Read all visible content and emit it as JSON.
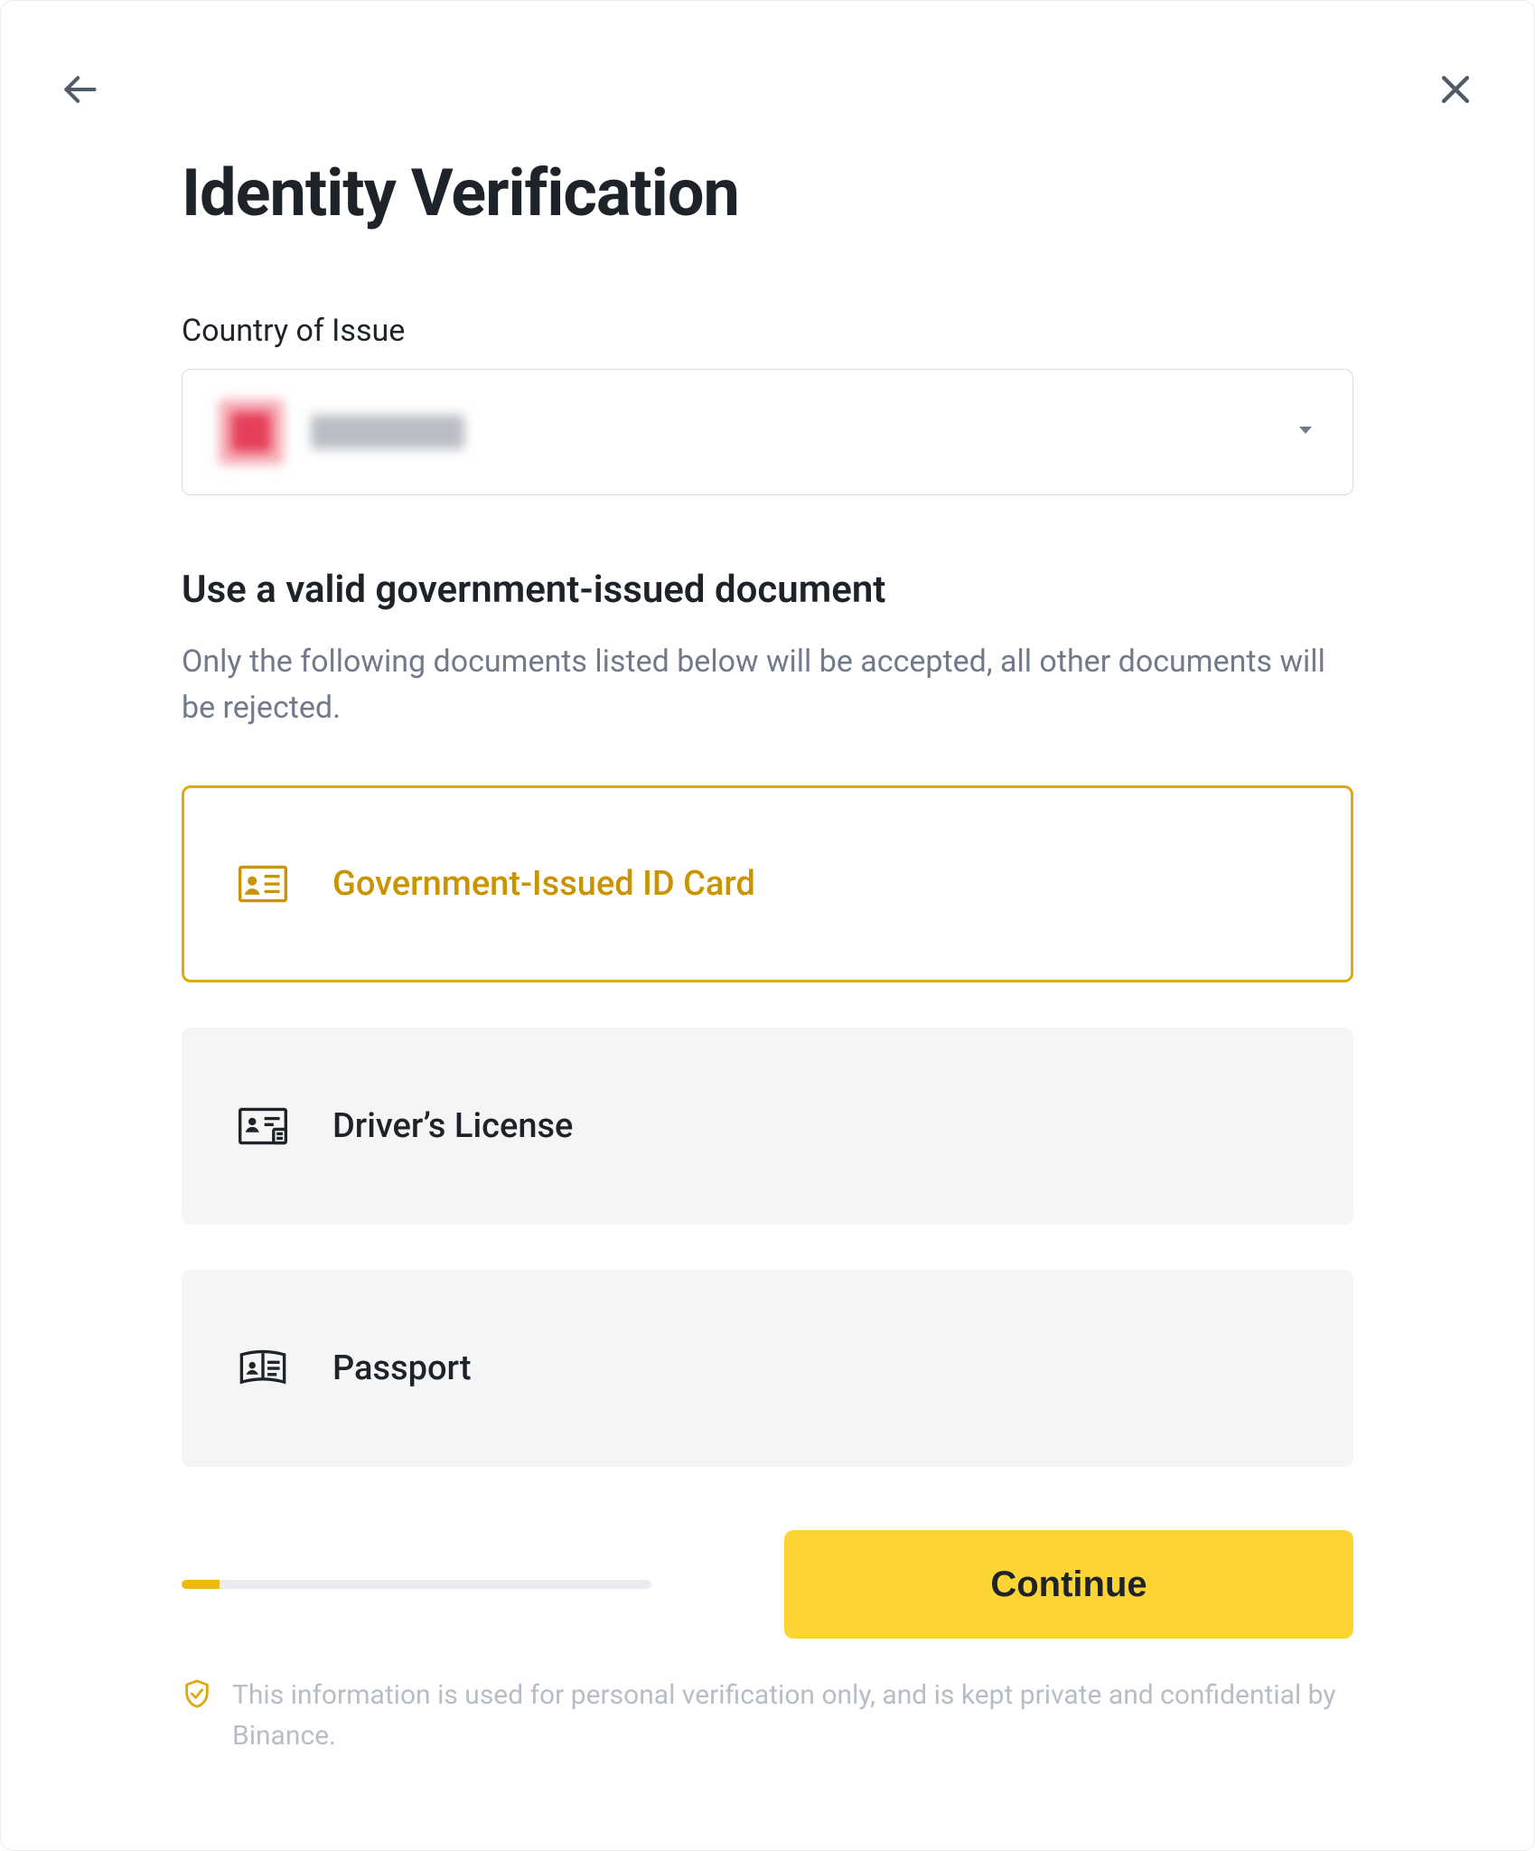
{
  "header": {
    "title": "Identity Verification"
  },
  "country": {
    "label": "Country of Issue",
    "selected_masked": true
  },
  "document": {
    "title": "Use a valid government-issued document",
    "helper": "Only the following documents listed below will be accepted, all other documents will be rejected.",
    "options": [
      {
        "id": "national-id",
        "label": "Government-Issued ID Card",
        "selected": true
      },
      {
        "id": "drivers-license",
        "label": "Driver’s License",
        "selected": false
      },
      {
        "id": "passport",
        "label": "Passport",
        "selected": false
      }
    ]
  },
  "progress": {
    "percent": 8
  },
  "actions": {
    "continue_label": "Continue"
  },
  "footer": {
    "privacy_note": "This information is used for personal verification only, and is kept private and confidential by Binance."
  },
  "colors": {
    "accent": "#fcd535",
    "accent_border": "#e0a80d",
    "text": "#1e2329",
    "muted": "#707a8a",
    "card_bg": "#f5f5f5"
  }
}
